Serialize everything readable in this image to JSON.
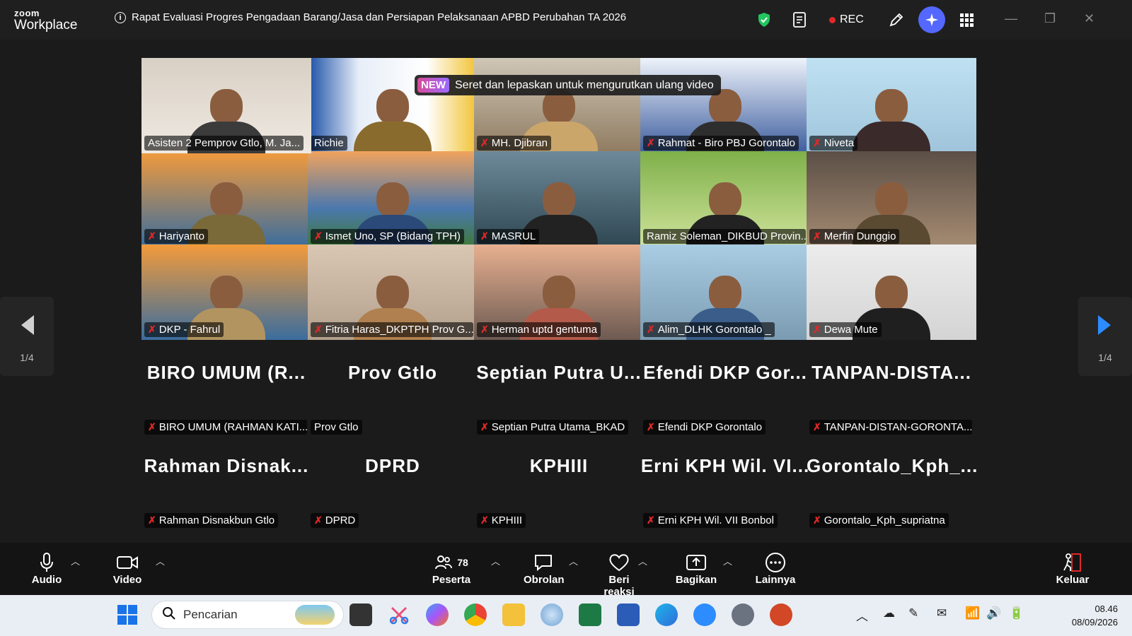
{
  "app": {
    "logo_top": "zoom",
    "logo_bottom": "Workplace"
  },
  "meeting": {
    "title": "Rapat Evaluasi Progres Pengadaan Barang/Jasa dan Persiapan Pelaksanaan APBD Perubahan TA 2026"
  },
  "titlebar": {
    "rec_label": "REC"
  },
  "tooltip": {
    "badge": "NEW",
    "text": "Seret dan lepaskan untuk mengurutkan ulang video"
  },
  "video_tiles": [
    {
      "name": "Asisten 2 Pemprov Gtlo,  M. Ja...",
      "muted": false
    },
    {
      "name": "Richie",
      "muted": false
    },
    {
      "name": "MH. Djibran",
      "muted": true
    },
    {
      "name": "Rahmat - Biro PBJ Gorontalo",
      "muted": true
    },
    {
      "name": "Niveta",
      "muted": true
    },
    {
      "name": "Hariyanto",
      "muted": true
    },
    {
      "name": "Ismet Uno, SP (Bidang TPH)",
      "muted": true
    },
    {
      "name": "MASRUL",
      "muted": true
    },
    {
      "name": "Ramiz Soleman_DIKBUD Provin...",
      "muted": false
    },
    {
      "name": "Merfin Dunggio",
      "muted": true
    },
    {
      "name": "DKP - Fahrul",
      "muted": true
    },
    {
      "name": "Fitria Haras_DKPTPH Prov G...",
      "muted": true
    },
    {
      "name": "Herman uptd gentuma",
      "muted": true
    },
    {
      "name": "Alim_DLHK Gorontalo _",
      "muted": true
    },
    {
      "name": "Dewa Mute",
      "muted": true
    }
  ],
  "name_tiles": [
    {
      "display": "BIRO UMUM (R...",
      "name": "BIRO UMUM (RAHMAN KATI...",
      "muted": true
    },
    {
      "display": "Prov Gtlo",
      "name": "Prov Gtlo",
      "muted": false
    },
    {
      "display": "Septian Putra U...",
      "name": "Septian Putra Utama_BKAD",
      "muted": true
    },
    {
      "display": "Efendi DKP Gor...",
      "name": "Efendi DKP Gorontalo",
      "muted": true
    },
    {
      "display": "TANPAN-DISTA...",
      "name": "TANPAN-DISTAN-GORONTA...",
      "muted": true
    },
    {
      "display": "Rahman Disnak...",
      "name": "Rahman Disnakbun Gtlo",
      "muted": true
    },
    {
      "display": "DPRD",
      "name": "DPRD",
      "muted": true
    },
    {
      "display": "KPHIII",
      "name": "KPHIII",
      "muted": true
    },
    {
      "display": "Erni KPH Wil. VI...",
      "name": "Erni KPH Wil. VII Bonbol",
      "muted": true
    },
    {
      "display": "Gorontalo_Kph_...",
      "name": "Gorontalo_Kph_supriatna",
      "muted": true
    }
  ],
  "pagination": {
    "left": "1/4",
    "right": "1/4"
  },
  "toolbar": {
    "audio": "Audio",
    "video": "Video",
    "participants": "Peserta",
    "participants_count": "78",
    "chat": "Obrolan",
    "react": "Beri reaksi",
    "share": "Bagikan",
    "more": "Lainnya",
    "leave": "Keluar"
  },
  "taskbar": {
    "search_placeholder": "Pencarian",
    "time": "08.46",
    "date": "08/09/2026"
  },
  "colors": {
    "active_speaker": "#2ed26b",
    "muted": "#e02828",
    "ai_button": "#5468ff"
  }
}
